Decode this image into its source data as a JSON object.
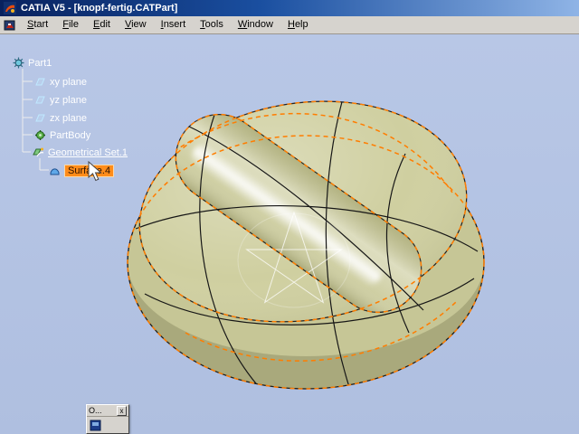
{
  "window": {
    "title": "CATIA V5 - [knopf-fertig.CATPart]"
  },
  "menu": {
    "items": [
      "Start",
      "File",
      "Edit",
      "View",
      "Insert",
      "Tools",
      "Window",
      "Help"
    ]
  },
  "tree": {
    "items": [
      {
        "label": "Part1",
        "icon": "part-icon"
      },
      {
        "label": "xy plane",
        "icon": "plane-icon"
      },
      {
        "label": "yz plane",
        "icon": "plane-icon"
      },
      {
        "label": "zx plane",
        "icon": "plane-icon"
      },
      {
        "label": "PartBody",
        "icon": "body-icon"
      },
      {
        "label": "Geometrical Set.1",
        "icon": "geometrical-set-icon"
      },
      {
        "label": "Surface.4",
        "icon": "surface-icon",
        "selected": true
      }
    ]
  },
  "floating_toolbar": {
    "title": "O...",
    "close_glyph": "x"
  },
  "colors": {
    "viewport_background": "#B3C3E2",
    "model_fill": "#C6C696",
    "model_top_fill": "#CFCFA0",
    "edge_color": "#1A1A1A",
    "highlight_edge_color": "#FF7D00",
    "selection_background": "#FF8C1A",
    "titlebar_gradient_start": "#08215E",
    "titlebar_gradient_end": "#8FB4E6",
    "menubar_background": "#D6D3CE",
    "tree_text_color": "#FFFFFF"
  }
}
